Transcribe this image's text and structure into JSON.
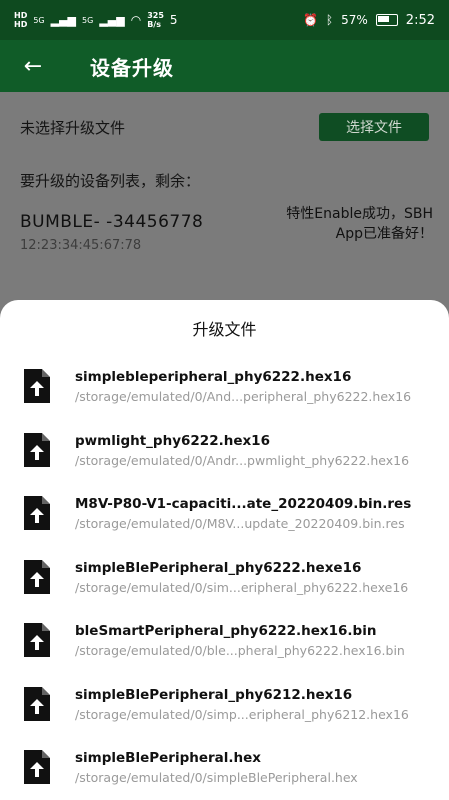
{
  "status_bar": {
    "left_labels": [
      "HD",
      "HD",
      "5G",
      "5G"
    ],
    "speed": "325",
    "speed_unit": "B/s",
    "extra": "5",
    "battery": "57%",
    "time": "2:52"
  },
  "app_bar": {
    "title": "设备升级"
  },
  "main": {
    "no_file_text": "未选择升级文件",
    "select_button": "选择文件",
    "device_list_label": "要升级的设备列表，剩余：",
    "device": {
      "name": "BUMBLE- -34456778",
      "mac": "12:23:34:45:67:78",
      "status": "特性Enable成功，SBH App已准备好！"
    }
  },
  "sheet": {
    "title": "升级文件",
    "files": [
      {
        "name": "simplebleperipheral_phy6222.hex16",
        "path": "/storage/emulated/0/And...peripheral_phy6222.hex16"
      },
      {
        "name": "pwmlight_phy6222.hex16",
        "path": "/storage/emulated/0/Andr...pwmlight_phy6222.hex16"
      },
      {
        "name": "M8V-P80-V1-capaciti...ate_20220409.bin.res",
        "path": "/storage/emulated/0/M8V...update_20220409.bin.res"
      },
      {
        "name": "simpleBlePeripheral_phy6222.hexe16",
        "path": "/storage/emulated/0/sim...eripheral_phy6222.hexe16"
      },
      {
        "name": "bleSmartPeripheral_phy6222.hex16.bin",
        "path": "/storage/emulated/0/ble...pheral_phy6222.hex16.bin"
      },
      {
        "name": "simpleBlePeripheral_phy6212.hex16",
        "path": "/storage/emulated/0/simp...eripheral_phy6212.hex16"
      },
      {
        "name": "simpleBlePeripheral.hex",
        "path": "/storage/emulated/0/simpleBlePeripheral.hex"
      }
    ]
  }
}
